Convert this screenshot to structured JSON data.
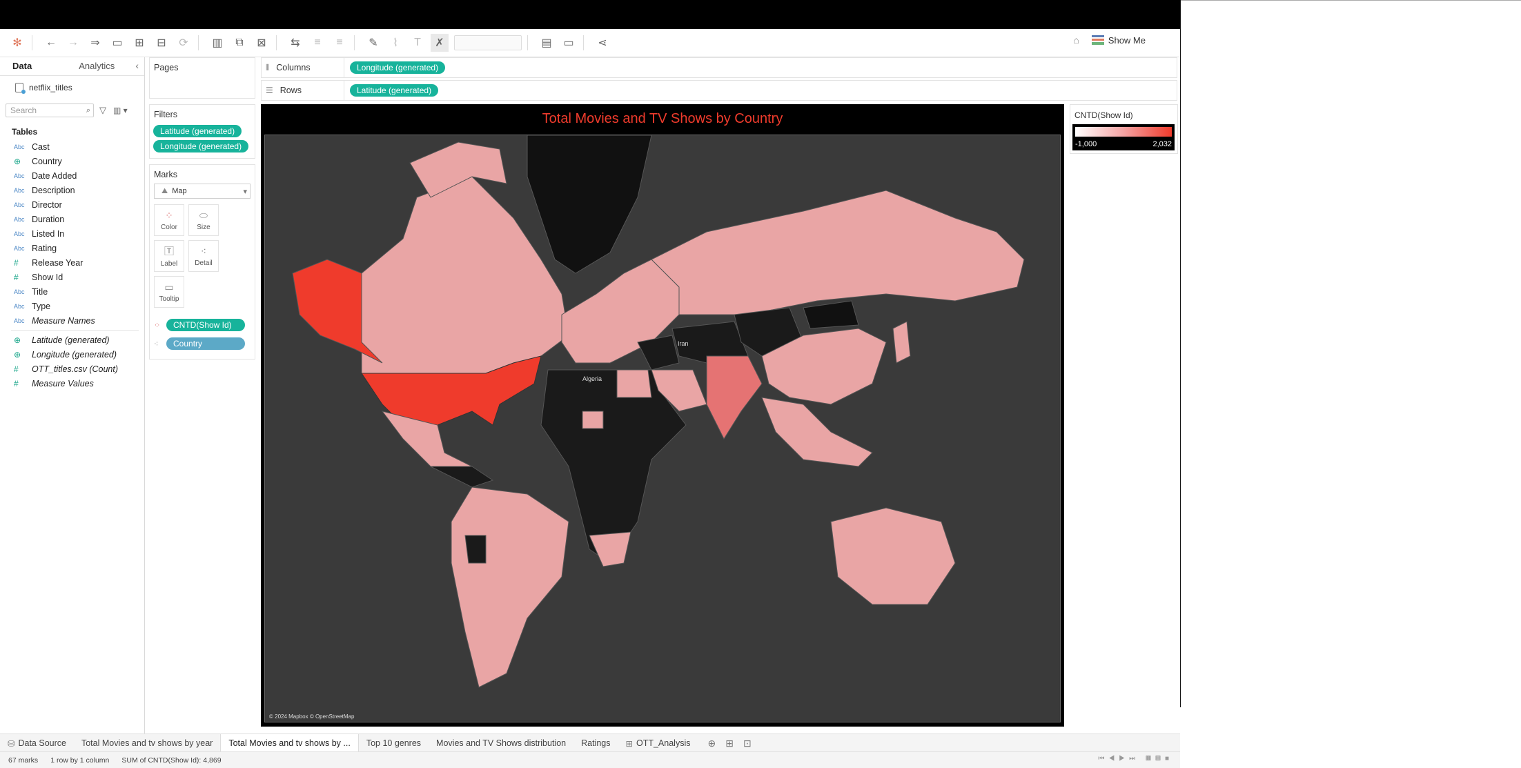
{
  "toolbar": {
    "show_me_label": "Show Me"
  },
  "data_pane": {
    "tab_data": "Data",
    "tab_analytics": "Analytics",
    "datasource_name": "netflix_titles",
    "search_placeholder": "Search",
    "tables_header": "Tables",
    "fields": [
      {
        "type": "Abc",
        "name": "Cast"
      },
      {
        "type": "globe",
        "name": "Country"
      },
      {
        "type": "Abc",
        "name": "Date Added"
      },
      {
        "type": "Abc",
        "name": "Description"
      },
      {
        "type": "Abc",
        "name": "Director"
      },
      {
        "type": "Abc",
        "name": "Duration"
      },
      {
        "type": "Abc",
        "name": "Listed In"
      },
      {
        "type": "Abc",
        "name": "Rating"
      },
      {
        "type": "#",
        "name": "Release Year"
      },
      {
        "type": "#",
        "name": "Show Id"
      },
      {
        "type": "Abc",
        "name": "Title"
      },
      {
        "type": "Abc",
        "name": "Type"
      },
      {
        "type": "Abc",
        "name": "Measure Names"
      },
      {
        "type": "globe",
        "name": "Latitude (generated)"
      },
      {
        "type": "globe",
        "name": "Longitude (generated)"
      },
      {
        "type": "#",
        "name": "OTT_titles.csv (Count)"
      },
      {
        "type": "#",
        "name": "Measure Values"
      }
    ]
  },
  "cards": {
    "pages_title": "Pages",
    "filters_title": "Filters",
    "filter_pills": [
      "Latitude (generated)",
      "Longitude (generated)"
    ],
    "marks_title": "Marks",
    "mark_type": "Map",
    "mark_buttons": [
      "Color",
      "Size",
      "Label",
      "Detail",
      "Tooltip"
    ],
    "mark_pills": [
      "CNTD(Show Id)",
      "Country"
    ]
  },
  "shelves": {
    "columns_label": "Columns",
    "columns_pill": "Longitude (generated)",
    "rows_label": "Rows",
    "rows_pill": "Latitude (generated)"
  },
  "viz": {
    "title": "Total Movies and TV Shows by Country",
    "attribution": "© 2024 Mapbox © OpenStreetMap",
    "labels": [
      "Algeria",
      "Iran"
    ],
    "colors": {
      "title": "#ef3b2c",
      "high": "#ef3b2c",
      "low": "#ffffff",
      "none": "#1a1a1a",
      "ocean": "#3a3a3a"
    }
  },
  "legend": {
    "title": "CNTD(Show Id)",
    "min": "-1,000",
    "max": "2,032"
  },
  "sheet_tabs": {
    "data_source": "Data Source",
    "tabs": [
      "Total Movies and tv shows by year",
      "Total Movies and tv shows by ...",
      "Top 10 genres",
      "Movies and TV Shows distribution",
      "Ratings",
      "OTT_Analysis"
    ],
    "active_index": 1
  },
  "status": {
    "marks": "67 marks",
    "rows": "1 row by 1 column",
    "sum": "SUM of CNTD(Show Id): 4,869"
  }
}
